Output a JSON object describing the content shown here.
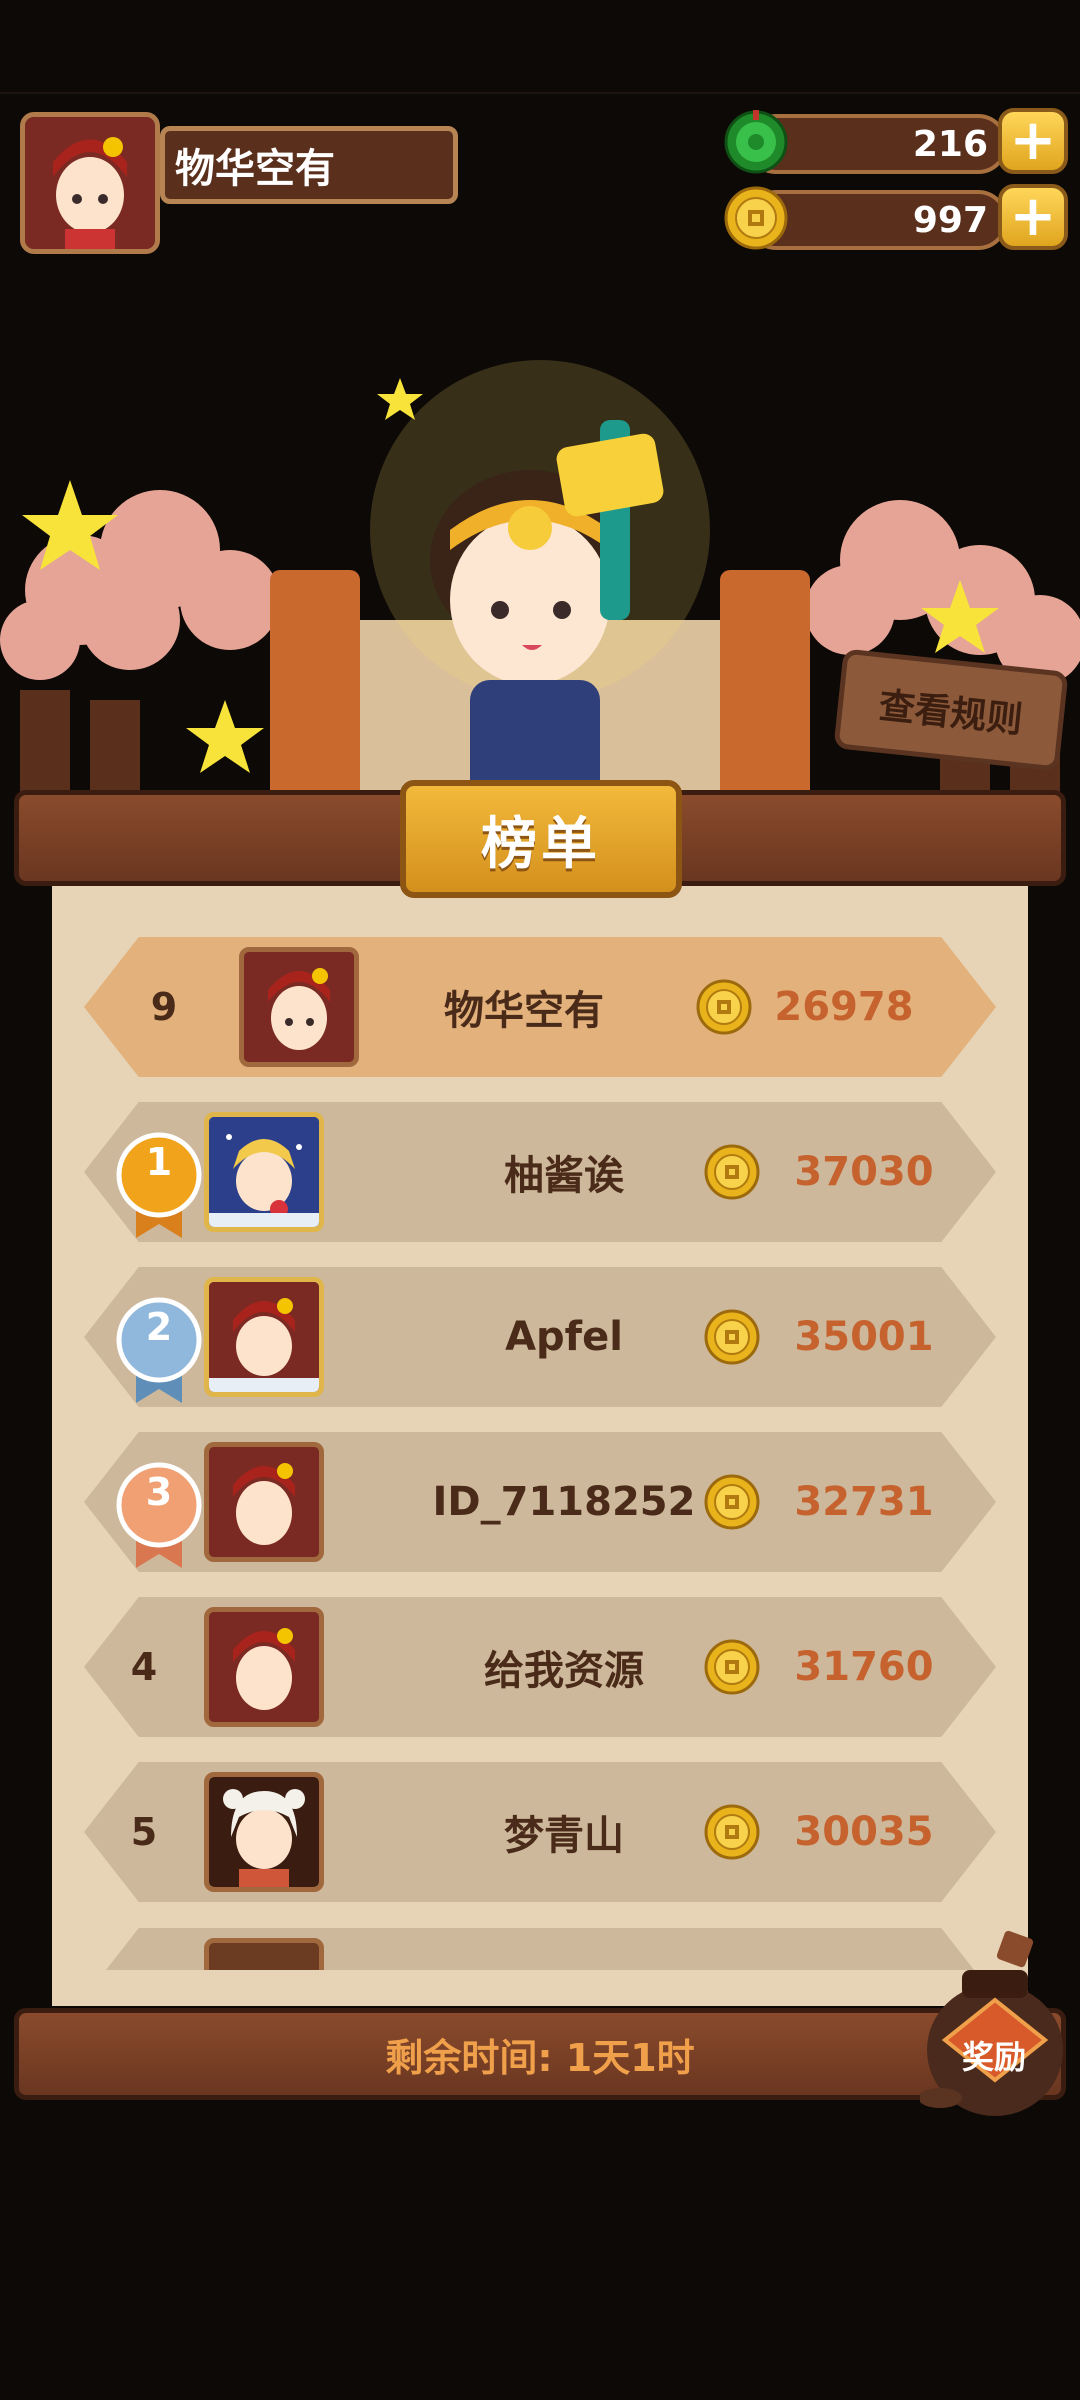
{
  "player": {
    "name": "物华空有"
  },
  "resources": {
    "jade": {
      "value": "216",
      "icon": "green-jade-icon"
    },
    "coins": {
      "value": "997",
      "icon": "gold-coin-icon"
    },
    "plus_label": "+"
  },
  "scene": {
    "rules_button": "查看规则"
  },
  "leaderboard": {
    "title": "榜单",
    "my_entry": {
      "rank": "9",
      "name": "物华空有",
      "score": "26978"
    },
    "entries": [
      {
        "rank": "1",
        "name": "柚酱诶",
        "score": "37030"
      },
      {
        "rank": "2",
        "name": "Apfel",
        "score": "35001"
      },
      {
        "rank": "3",
        "name": "ID_7118252",
        "score": "32731"
      },
      {
        "rank": "4",
        "name": "给我资源",
        "score": "31760"
      },
      {
        "rank": "5",
        "name": "梦青山",
        "score": "30035"
      }
    ],
    "remaining_time": "剩余时间: 1天1时",
    "reward_button": "奖励"
  },
  "colors": {
    "background": "#0d0906",
    "parchment": "#e7d4b6",
    "row": "#ceb89b",
    "my_row": "#e2b17c",
    "score_text": "#c5622e",
    "medal_gold": "#f2a31c",
    "medal_silver": "#8fb8dc",
    "medal_bronze": "#f0a072"
  }
}
